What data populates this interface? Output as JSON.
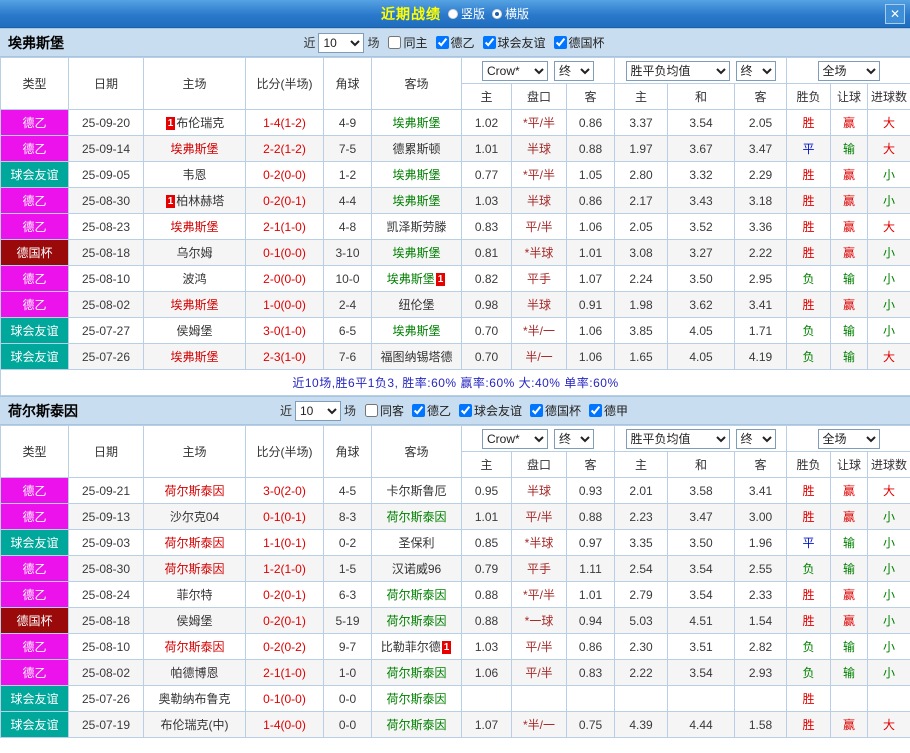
{
  "titlebar": {
    "title": "近期战绩",
    "radio_vertical": "竖版",
    "radio_horizontal": "横版",
    "selected": "横版",
    "close": "✕"
  },
  "labels": {
    "near": "近",
    "count": "10",
    "games": "场",
    "company": "Crow*",
    "final": "终",
    "odds_avg": "胜平负均值",
    "scope": "全场"
  },
  "columns": {
    "type": "类型",
    "date": "日期",
    "home": "主场",
    "score": "比分(半场)",
    "corner": "角球",
    "away": "客场",
    "asian_home": "主",
    "handicap": "盘口",
    "asian_away": "客",
    "euro_home": "主",
    "euro_draw": "和",
    "euro_away": "客",
    "result": "胜负",
    "handicap_result": "让球",
    "goals": "进球数"
  },
  "colors": {
    "league": {
      "德乙": "#EC12EC",
      "球会友谊": "#00A79B",
      "德国杯": "#9B0A0A",
      "德甲": "#3366CC"
    },
    "team": {
      "red": "#D40000",
      "green": "#008000",
      "black": "#333333"
    },
    "result": {
      "胜": "#E00000",
      "平": "#0013C8",
      "负": "#008000",
      "赢": "#E00000",
      "输": "#008000",
      "大": "#E00000",
      "小": "#008000"
    },
    "score": "#E00000",
    "handicap": "#A52A2A",
    "summary": "#2626C0"
  },
  "sections": [
    {
      "team": "埃弗斯堡",
      "filter_checkboxes": [
        {
          "label": "同主",
          "checked": false
        },
        {
          "label": "德乙",
          "checked": true
        },
        {
          "label": "球会友谊",
          "checked": true
        },
        {
          "label": "德国杯",
          "checked": true
        }
      ],
      "summary": "近10场,胜6平1负3, 胜率:60% 赢率:60% 大:40% 单率:60%",
      "rows": [
        {
          "league": "德乙",
          "date": "25-09-20",
          "home": {
            "name": "布伦瑞克",
            "color": "black",
            "badge": "1",
            "badge_pos": "before"
          },
          "score": "1-4(1-2)",
          "corners": "4-9",
          "away": {
            "name": "埃弗斯堡",
            "color": "green"
          },
          "asian": [
            "1.02",
            "*平/半",
            "0.86"
          ],
          "euro": [
            "3.37",
            "3.54",
            "2.05"
          ],
          "results": [
            "胜",
            "赢",
            "大"
          ]
        },
        {
          "league": "德乙",
          "date": "25-09-14",
          "home": {
            "name": "埃弗斯堡",
            "color": "red"
          },
          "score": "2-2(1-2)",
          "corners": "7-5",
          "away": {
            "name": "德累斯顿",
            "color": "black"
          },
          "asian": [
            "1.01",
            "半球",
            "0.88"
          ],
          "euro": [
            "1.97",
            "3.67",
            "3.47"
          ],
          "results": [
            "平",
            "输",
            "大"
          ]
        },
        {
          "league": "球会友谊",
          "date": "25-09-05",
          "home": {
            "name": "韦恩",
            "color": "black"
          },
          "score": "0-2(0-0)",
          "corners": "1-2",
          "away": {
            "name": "埃弗斯堡",
            "color": "green"
          },
          "asian": [
            "0.77",
            "*平/半",
            "1.05"
          ],
          "euro": [
            "2.80",
            "3.32",
            "2.29"
          ],
          "results": [
            "胜",
            "赢",
            "小"
          ]
        },
        {
          "league": "德乙",
          "date": "25-08-30",
          "home": {
            "name": "柏林赫塔",
            "color": "black",
            "badge": "1",
            "badge_pos": "before"
          },
          "score": "0-2(0-1)",
          "corners": "4-4",
          "away": {
            "name": "埃弗斯堡",
            "color": "green"
          },
          "asian": [
            "1.03",
            "半球",
            "0.86"
          ],
          "euro": [
            "2.17",
            "3.43",
            "3.18"
          ],
          "results": [
            "胜",
            "赢",
            "小"
          ]
        },
        {
          "league": "德乙",
          "date": "25-08-23",
          "home": {
            "name": "埃弗斯堡",
            "color": "red"
          },
          "score": "2-1(1-0)",
          "corners": "4-8",
          "away": {
            "name": "凯泽斯劳滕",
            "color": "black"
          },
          "asian": [
            "0.83",
            "平/半",
            "1.06"
          ],
          "euro": [
            "2.05",
            "3.52",
            "3.36"
          ],
          "results": [
            "胜",
            "赢",
            "大"
          ]
        },
        {
          "league": "德国杯",
          "date": "25-08-18",
          "home": {
            "name": "乌尔姆",
            "color": "black"
          },
          "score": "0-1(0-0)",
          "corners": "3-10",
          "away": {
            "name": "埃弗斯堡",
            "color": "green"
          },
          "asian": [
            "0.81",
            "*半球",
            "1.01"
          ],
          "euro": [
            "3.08",
            "3.27",
            "2.22"
          ],
          "results": [
            "胜",
            "赢",
            "小"
          ]
        },
        {
          "league": "德乙",
          "date": "25-08-10",
          "home": {
            "name": "波鸿",
            "color": "black"
          },
          "score": "2-0(0-0)",
          "corners": "10-0",
          "away": {
            "name": "埃弗斯堡",
            "color": "green",
            "badge": "1",
            "badge_pos": "after"
          },
          "asian": [
            "0.82",
            "平手",
            "1.07"
          ],
          "euro": [
            "2.24",
            "3.50",
            "2.95"
          ],
          "results": [
            "负",
            "输",
            "小"
          ]
        },
        {
          "league": "德乙",
          "date": "25-08-02",
          "home": {
            "name": "埃弗斯堡",
            "color": "red"
          },
          "score": "1-0(0-0)",
          "corners": "2-4",
          "away": {
            "name": "纽伦堡",
            "color": "black"
          },
          "asian": [
            "0.98",
            "半球",
            "0.91"
          ],
          "euro": [
            "1.98",
            "3.62",
            "3.41"
          ],
          "results": [
            "胜",
            "赢",
            "小"
          ]
        },
        {
          "league": "球会友谊",
          "date": "25-07-27",
          "home": {
            "name": "侯姆堡",
            "color": "black"
          },
          "score": "3-0(1-0)",
          "corners": "6-5",
          "away": {
            "name": "埃弗斯堡",
            "color": "green"
          },
          "asian": [
            "0.70",
            "*半/一",
            "1.06"
          ],
          "euro": [
            "3.85",
            "4.05",
            "1.71"
          ],
          "results": [
            "负",
            "输",
            "小"
          ]
        },
        {
          "league": "球会友谊",
          "date": "25-07-26",
          "home": {
            "name": "埃弗斯堡",
            "color": "red"
          },
          "score": "2-3(1-0)",
          "corners": "7-6",
          "away": {
            "name": "福图纳锡塔德",
            "color": "black"
          },
          "asian": [
            "0.70",
            "半/一",
            "1.06"
          ],
          "euro": [
            "1.65",
            "4.05",
            "4.19"
          ],
          "results": [
            "负",
            "输",
            "大"
          ]
        }
      ]
    },
    {
      "team": "荷尔斯泰因",
      "filter_checkboxes": [
        {
          "label": "同客",
          "checked": false
        },
        {
          "label": "德乙",
          "checked": true
        },
        {
          "label": "球会友谊",
          "checked": true
        },
        {
          "label": "德国杯",
          "checked": true
        },
        {
          "label": "德甲",
          "checked": true
        }
      ],
      "rows": [
        {
          "league": "德乙",
          "date": "25-09-21",
          "home": {
            "name": "荷尔斯泰因",
            "color": "red"
          },
          "score": "3-0(2-0)",
          "corners": "4-5",
          "away": {
            "name": "卡尔斯鲁厄",
            "color": "black"
          },
          "asian": [
            "0.95",
            "半球",
            "0.93"
          ],
          "euro": [
            "2.01",
            "3.58",
            "3.41"
          ],
          "results": [
            "胜",
            "赢",
            "大"
          ]
        },
        {
          "league": "德乙",
          "date": "25-09-13",
          "home": {
            "name": "沙尔克04",
            "color": "black"
          },
          "score": "0-1(0-1)",
          "corners": "8-3",
          "away": {
            "name": "荷尔斯泰因",
            "color": "green"
          },
          "asian": [
            "1.01",
            "平/半",
            "0.88"
          ],
          "euro": [
            "2.23",
            "3.47",
            "3.00"
          ],
          "results": [
            "胜",
            "赢",
            "小"
          ]
        },
        {
          "league": "球会友谊",
          "date": "25-09-03",
          "home": {
            "name": "荷尔斯泰因",
            "color": "red"
          },
          "score": "1-1(0-1)",
          "corners": "0-2",
          "away": {
            "name": "圣保利",
            "color": "black"
          },
          "asian": [
            "0.85",
            "*半球",
            "0.97"
          ],
          "euro": [
            "3.35",
            "3.50",
            "1.96"
          ],
          "results": [
            "平",
            "输",
            "小"
          ]
        },
        {
          "league": "德乙",
          "date": "25-08-30",
          "home": {
            "name": "荷尔斯泰因",
            "color": "red"
          },
          "score": "1-2(1-0)",
          "corners": "1-5",
          "away": {
            "name": "汉诺威96",
            "color": "black"
          },
          "asian": [
            "0.79",
            "平手",
            "1.11"
          ],
          "euro": [
            "2.54",
            "3.54",
            "2.55"
          ],
          "results": [
            "负",
            "输",
            "小"
          ]
        },
        {
          "league": "德乙",
          "date": "25-08-24",
          "home": {
            "name": "菲尔特",
            "color": "black"
          },
          "score": "0-2(0-1)",
          "corners": "6-3",
          "away": {
            "name": "荷尔斯泰因",
            "color": "green"
          },
          "asian": [
            "0.88",
            "*平/半",
            "1.01"
          ],
          "euro": [
            "2.79",
            "3.54",
            "2.33"
          ],
          "results": [
            "胜",
            "赢",
            "小"
          ]
        },
        {
          "league": "德国杯",
          "date": "25-08-18",
          "home": {
            "name": "侯姆堡",
            "color": "black"
          },
          "score": "0-2(0-1)",
          "corners": "5-19",
          "away": {
            "name": "荷尔斯泰因",
            "color": "green"
          },
          "asian": [
            "0.88",
            "*一球",
            "0.94"
          ],
          "euro": [
            "5.03",
            "4.51",
            "1.54"
          ],
          "results": [
            "胜",
            "赢",
            "小"
          ]
        },
        {
          "league": "德乙",
          "date": "25-08-10",
          "home": {
            "name": "荷尔斯泰因",
            "color": "red"
          },
          "score": "0-2(0-2)",
          "corners": "9-7",
          "away": {
            "name": "比勒菲尔德",
            "color": "black",
            "badge": "1",
            "badge_pos": "after"
          },
          "asian": [
            "1.03",
            "平/半",
            "0.86"
          ],
          "euro": [
            "2.30",
            "3.51",
            "2.82"
          ],
          "results": [
            "负",
            "输",
            "小"
          ]
        },
        {
          "league": "德乙",
          "date": "25-08-02",
          "home": {
            "name": "帕德博恩",
            "color": "black"
          },
          "score": "2-1(1-0)",
          "corners": "1-0",
          "away": {
            "name": "荷尔斯泰因",
            "color": "green"
          },
          "asian": [
            "1.06",
            "平/半",
            "0.83"
          ],
          "euro": [
            "2.22",
            "3.54",
            "2.93"
          ],
          "results": [
            "负",
            "输",
            "小"
          ]
        },
        {
          "league": "球会友谊",
          "date": "25-07-26",
          "home": {
            "name": "奥勒纳布鲁克",
            "color": "black"
          },
          "score": "0-1(0-0)",
          "corners": "0-0",
          "away": {
            "name": "荷尔斯泰因",
            "color": "green"
          },
          "asian": [
            "",
            "",
            ""
          ],
          "euro": [
            "",
            "",
            ""
          ],
          "results": [
            "胜",
            "",
            ""
          ]
        },
        {
          "league": "球会友谊",
          "date": "25-07-19",
          "home": {
            "name": "布伦瑞克(中)",
            "color": "black"
          },
          "score": "1-4(0-0)",
          "corners": "0-0",
          "away": {
            "name": "荷尔斯泰因",
            "color": "green"
          },
          "asian": [
            "1.07",
            "*半/一",
            "0.75"
          ],
          "euro": [
            "4.39",
            "4.44",
            "1.58"
          ],
          "results": [
            "胜",
            "赢",
            "大"
          ]
        }
      ]
    }
  ]
}
